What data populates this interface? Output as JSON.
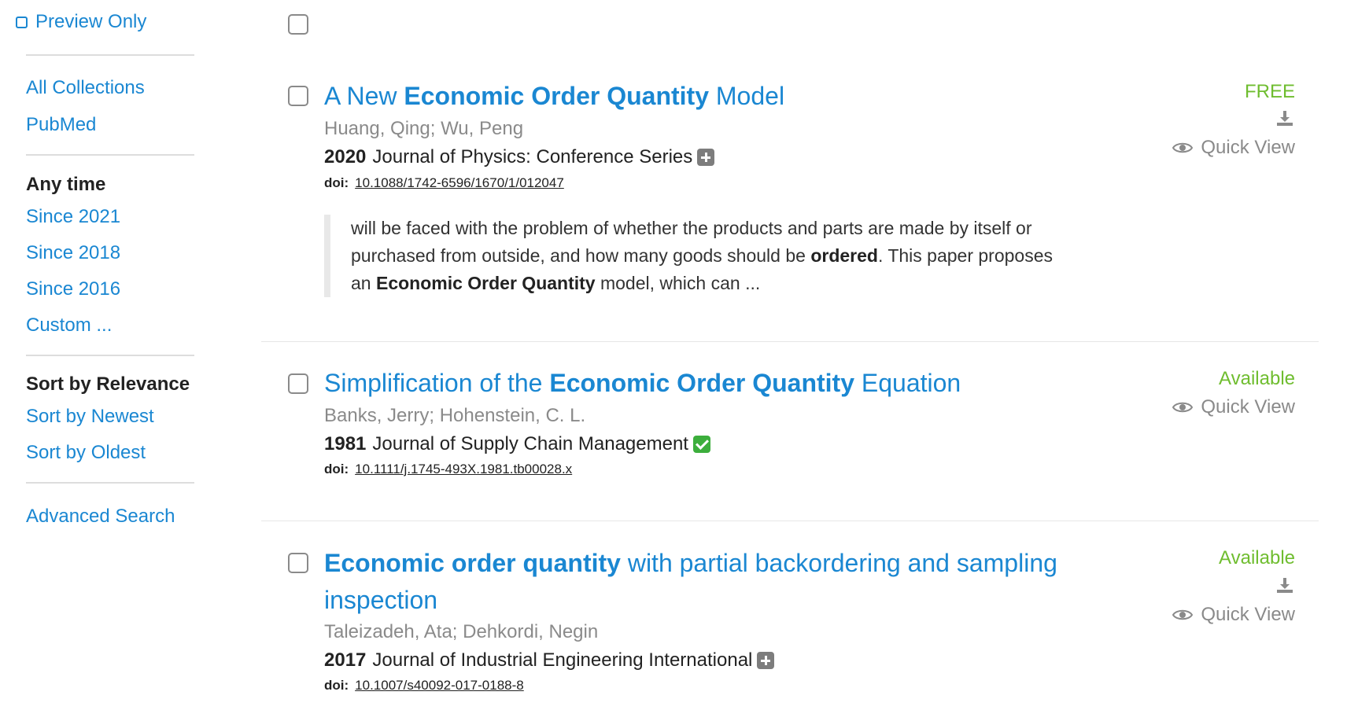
{
  "sidebar": {
    "preview_only": "Preview Only",
    "collections": [
      "All Collections",
      "PubMed"
    ],
    "time_heading": "Any time",
    "time_filters": [
      "Since 2021",
      "Since 2018",
      "Since 2016",
      "Custom ..."
    ],
    "sort_heading": "Sort by Relevance",
    "sort_options": [
      "Sort by Newest",
      "Sort by Oldest"
    ],
    "advanced_search": "Advanced Search"
  },
  "results": [
    {
      "title_pre": "A New ",
      "title_bold": "Economic Order Quantity",
      "title_post": " Model",
      "authors": "Huang, Qing; Wu, Peng",
      "year": "2020",
      "journal": "Journal of Physics: Conference Series",
      "doi_label": "doi:",
      "doi": "10.1088/1742-6596/1670/1/012047",
      "access": "FREE",
      "quick_view": "Quick View",
      "snippet": {
        "part1": "will be faced with the problem of whether the products and parts are made by itself or purchased from outside, and how many goods should be ",
        "bold1": "ordered",
        "part2": ". This paper proposes an ",
        "bold2": "Economic Order Quantity",
        "part3": " model, which can ..."
      }
    },
    {
      "title_pre": "Simplification of the ",
      "title_bold": "Economic Order Quantity",
      "title_post": " Equation",
      "authors": "Banks, Jerry; Hohenstein, C. L.",
      "year": "1981",
      "journal": "Journal of Supply Chain Management",
      "doi_label": "doi:",
      "doi": "10.1111/j.1745-493X.1981.tb00028.x",
      "access": "Available",
      "quick_view": "Quick View"
    },
    {
      "title_pre": "",
      "title_bold": "Economic order quantity",
      "title_post": " with partial backordering and sampling inspection",
      "authors": "Taleizadeh, Ata; Dehkordi, Negin",
      "year": "2017",
      "journal": "Journal of Industrial Engineering International",
      "doi_label": "doi:",
      "doi": "10.1007/s40092-017-0188-8",
      "access": "Available",
      "quick_view": "Quick View"
    }
  ],
  "colors": {
    "link": "#1a87d2",
    "free_available": "#6fbd2f",
    "muted": "#8a8a8a",
    "check_badge": "#3cae3c"
  },
  "icons": [
    "checkbox-icon",
    "plus-icon",
    "check-icon",
    "download-icon",
    "eye-icon"
  ]
}
